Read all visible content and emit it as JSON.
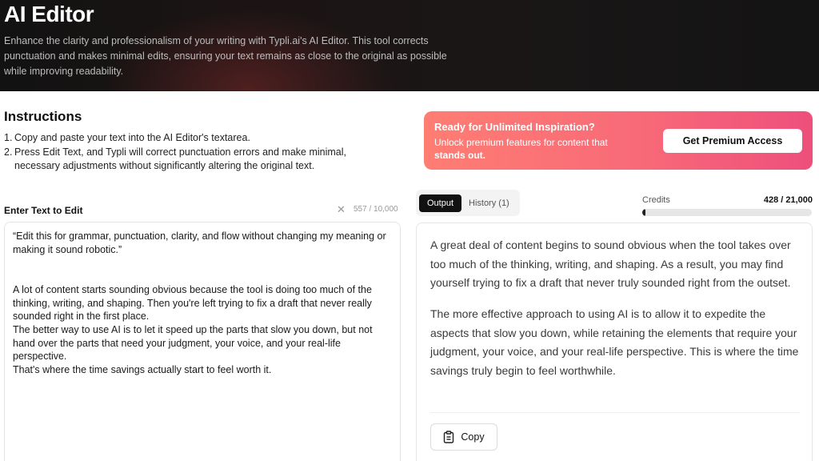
{
  "hero": {
    "title": "AI Editor",
    "description": "Enhance the clarity and professionalism of your writing with Typli.ai's AI Editor. This tool corrects punctuation and makes minimal edits, ensuring your text remains as close to the original as possible while improving readability."
  },
  "instructions": {
    "title": "Instructions",
    "items": [
      {
        "num": "1.",
        "text": "Copy and paste your text into the AI Editor's textarea."
      },
      {
        "num": "2.",
        "text": "Press Edit Text, and Typli will correct punctuation errors and make minimal, necessary adjustments without significantly altering the original text."
      }
    ]
  },
  "promo": {
    "title": "Ready for Unlimited Inspiration?",
    "subtitle_prefix": "Unlock premium features for content that ",
    "subtitle_bold": "stands out.",
    "button_label": "Get Premium Access",
    "gradient_start": "#ff7d73",
    "gradient_end": "#ee4f7c"
  },
  "editor": {
    "label": "Enter Text to Edit",
    "clear_icon": "close-icon",
    "char_count": "557 / 10,000",
    "text": "“Edit this for grammar, punctuation, clarity, and flow without changing my meaning or making it sound robotic.”\n\n\nA lot of content starts sounding obvious because the tool is doing too much of the thinking, writing, and shaping. Then you're left trying to fix a draft that never really sounded right in the first place.\nThe better way to use AI is to let it speed up the parts that slow you down, but not hand over the parts that need your judgment, your voice, and your real-life perspective.\nThat's where the time savings actually start to feel worth it."
  },
  "tabs": {
    "output_label": "Output",
    "history_label": "History (1)"
  },
  "credits": {
    "label": "Credits",
    "value": "428 / 21,000",
    "fraction_used": 0.0204
  },
  "output": {
    "paragraphs": [
      "A great deal of content begins to sound obvious when the tool takes over too much of the thinking, writing, and shaping. As a result, you may find yourself trying to fix a draft that never truly sounded right from the outset.",
      "The more effective approach to using AI is to allow it to expedite the aspects that slow you down, while retaining the elements that require your judgment, your voice, and your real-life perspective. This is where the time savings truly begin to feel worthwhile."
    ],
    "copy_label": "Copy",
    "copy_icon": "clipboard-icon"
  }
}
